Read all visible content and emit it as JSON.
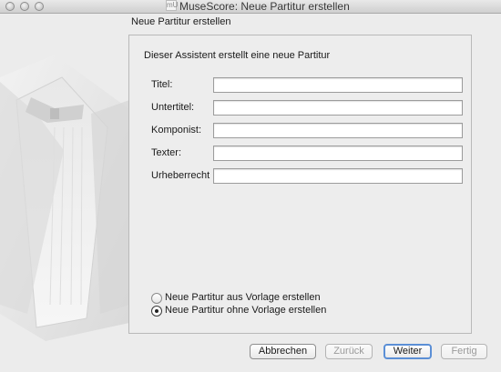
{
  "window": {
    "title": "MuseScore: Neue Partitur erstellen",
    "app_icon_glyph": "mU"
  },
  "page": {
    "heading": "Neue Partitur erstellen",
    "intro": "Dieser Assistent erstellt eine neue Partitur"
  },
  "fields": [
    {
      "label": "Titel:",
      "value": "",
      "placeholder": ""
    },
    {
      "label": "Untertitel:",
      "value": "",
      "placeholder": ""
    },
    {
      "label": "Komponist:",
      "value": "",
      "placeholder": ""
    },
    {
      "label": "Texter:",
      "value": "",
      "placeholder": ""
    },
    {
      "label": "Urheberrecht",
      "value": "",
      "placeholder": ""
    }
  ],
  "template_options": [
    {
      "label": "Neue Partitur aus Vorlage erstellen",
      "checked": false
    },
    {
      "label": "Neue Partitur ohne Vorlage erstellen",
      "checked": true
    }
  ],
  "buttons": {
    "cancel": "Abbrechen",
    "back": "Zurück",
    "next": "Weiter",
    "finish": "Fertig"
  },
  "colors": {
    "default_button_ring": "#5b8fd6",
    "disabled_text": "#9a9a9a"
  }
}
